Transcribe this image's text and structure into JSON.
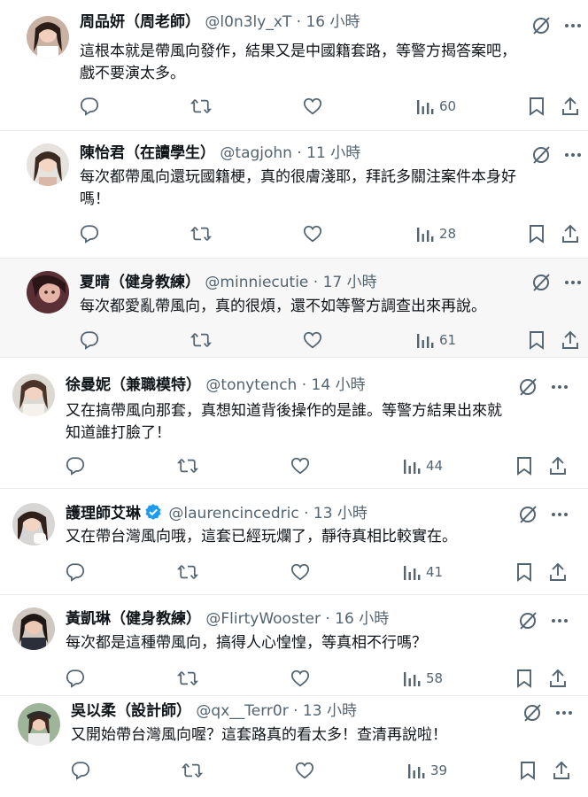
{
  "posts": [
    {
      "name": "周品妍（周老師）",
      "handle": "@l0n3ly_xT",
      "time": "16 小時",
      "text": "這根本就是帶風向發作，結果又是中國籍套路，等警方揭答案吧，\n戲不要演太多。",
      "views": "60",
      "verified": false
    },
    {
      "name": "陳怡君（在讀學生）",
      "handle": "@tagjohn",
      "time": "11 小時",
      "text": "每次都帶風向還玩國籍梗，真的很膚淺耶，拜託多關注案件本身好\n嗎！",
      "views": "28",
      "verified": false
    },
    {
      "name": "夏晴（健身教練）",
      "handle": "@minniecutie",
      "time": "17 小時",
      "text": "每次都愛亂帶風向，真的很煩，還不如等警方調查出來再說。",
      "views": "61",
      "verified": false
    },
    {
      "name": "徐曼妮（兼職模特）",
      "handle": "@tonytench",
      "time": "14 小時",
      "text": "又在搞帶風向那套，真想知道背後操作的是誰。等警方結果出來就\n知道誰打臉了！",
      "views": "44",
      "verified": false
    },
    {
      "name": "護理師艾琳",
      "handle": "@laurencincedric",
      "time": "13 小時",
      "text": "又在帶台灣風向哦，這套已經玩爛了，靜待真相比較實在。",
      "views": "41",
      "verified": true
    },
    {
      "name": "黃凱琳（健身教練）",
      "handle": "@FlirtyWooster",
      "time": "16 小時",
      "text": "每次都是這種帶風向，搞得人心惶惶，等真相不行嗎？",
      "views": "58",
      "verified": false
    },
    {
      "name": "吳以柔（設計師）",
      "handle": "@qx__Terr0r",
      "time": "13 小時",
      "text": "又開始帶台灣風向喔？這套路真的看太多！查清再說啦！",
      "views": "39",
      "verified": false
    }
  ],
  "separator": "·",
  "colors": {
    "text": "#0f1419",
    "secondary": "#536471",
    "verified": "#1d9bf0",
    "border": "#e7e9ea"
  },
  "icons": [
    "reply-icon",
    "repost-icon",
    "like-icon",
    "views-icon",
    "bookmark-icon",
    "share-icon",
    "grok-icon",
    "more-icon",
    "verified-badge-icon"
  ]
}
